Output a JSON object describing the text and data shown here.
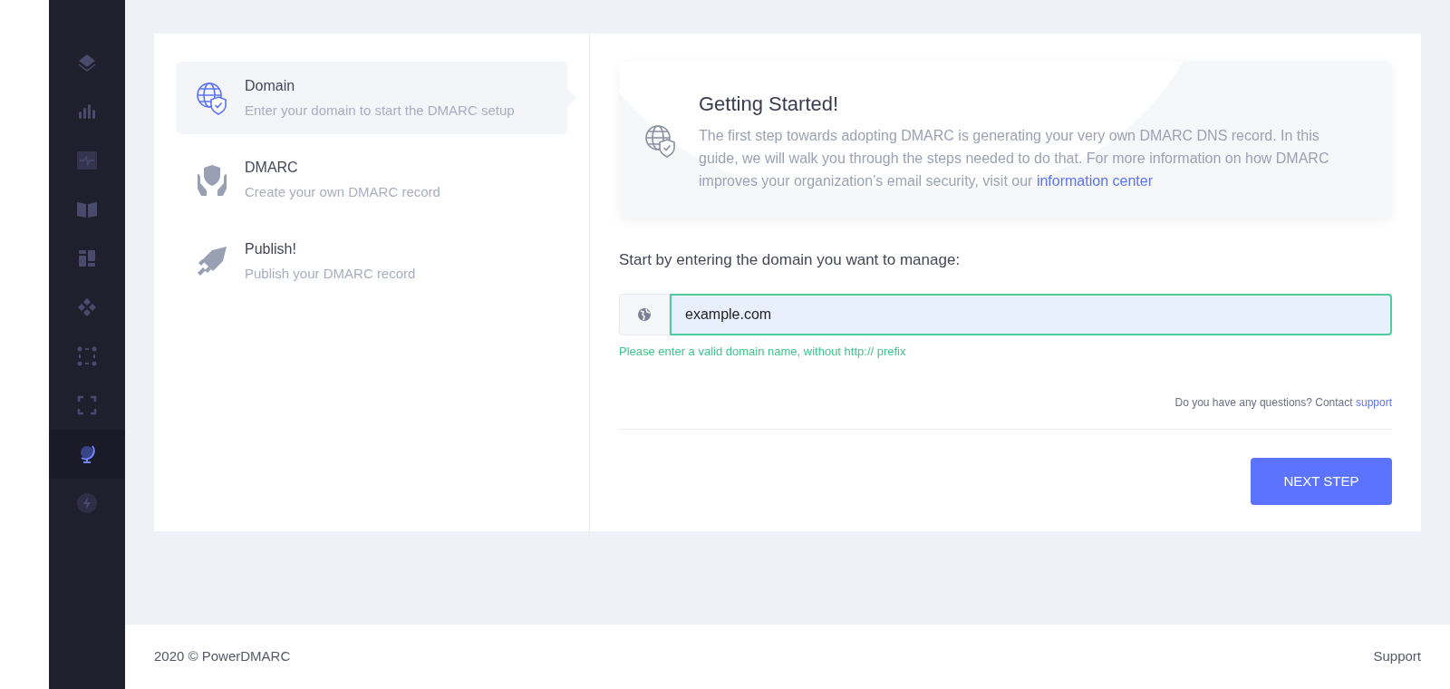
{
  "sidebar": {
    "items": [
      {
        "selected": false
      },
      {
        "selected": false
      },
      {
        "selected": false
      },
      {
        "selected": false
      },
      {
        "selected": false
      },
      {
        "selected": false
      },
      {
        "selected": false
      },
      {
        "selected": false
      },
      {
        "selected": true
      },
      {
        "selected": false
      }
    ]
  },
  "steps": [
    {
      "title": "Domain",
      "description": "Enter your domain to start the DMARC setup",
      "selected": true
    },
    {
      "title": "DMARC",
      "description": "Create your own DMARC record",
      "selected": false
    },
    {
      "title": "Publish!",
      "description": "Publish your DMARC record",
      "selected": false
    }
  ],
  "intro": {
    "title": "Getting Started!",
    "text": "The first step towards adopting DMARC is generating your very own DMARC DNS record. In this guide, we will walk you through the steps needed to do that. For more information on how DMARC improves your organization’s email security, visit our",
    "link": "information center"
  },
  "domain_form": {
    "label": "Start by entering the domain you want to manage:",
    "value": "example.com",
    "valid": true,
    "hint": "Please enter a valid domain name, without http:// prefix"
  },
  "help": {
    "text": "Do you have any questions? Contact",
    "link": "support"
  },
  "next_button": "NEXT STEP",
  "footer": {
    "copyright": "2020 © PowerDMARC",
    "link": "Support"
  }
}
